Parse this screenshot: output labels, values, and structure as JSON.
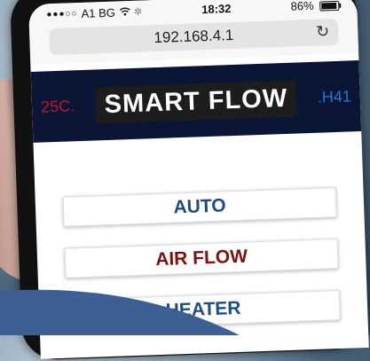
{
  "status": {
    "carrier": "A1 BG",
    "time": "18:32",
    "battery": "86%",
    "battery_level": 0.86,
    "icons": [
      "signal-dots-icon",
      "wifi-icon",
      "activity-spinner-icon",
      "battery-icon"
    ]
  },
  "browser": {
    "url": "192.168.4.1",
    "reload_icon": "reload-icon"
  },
  "banner": {
    "temperature": "25C.",
    "title": "SMART FLOW",
    "humidity": ".H41"
  },
  "buttons": {
    "auto": "AUTO",
    "air_flow": "AIR FLOW",
    "heater": "HEATER"
  },
  "colors": {
    "banner_bg": "#0b1535",
    "temperature": "#c0162b",
    "humidity": "#2d6fd8",
    "auto_text": "#1f4a82",
    "air_flow_text": "#7a1212",
    "heater_text": "#1f4a82",
    "overlay": "#3d5f93"
  }
}
